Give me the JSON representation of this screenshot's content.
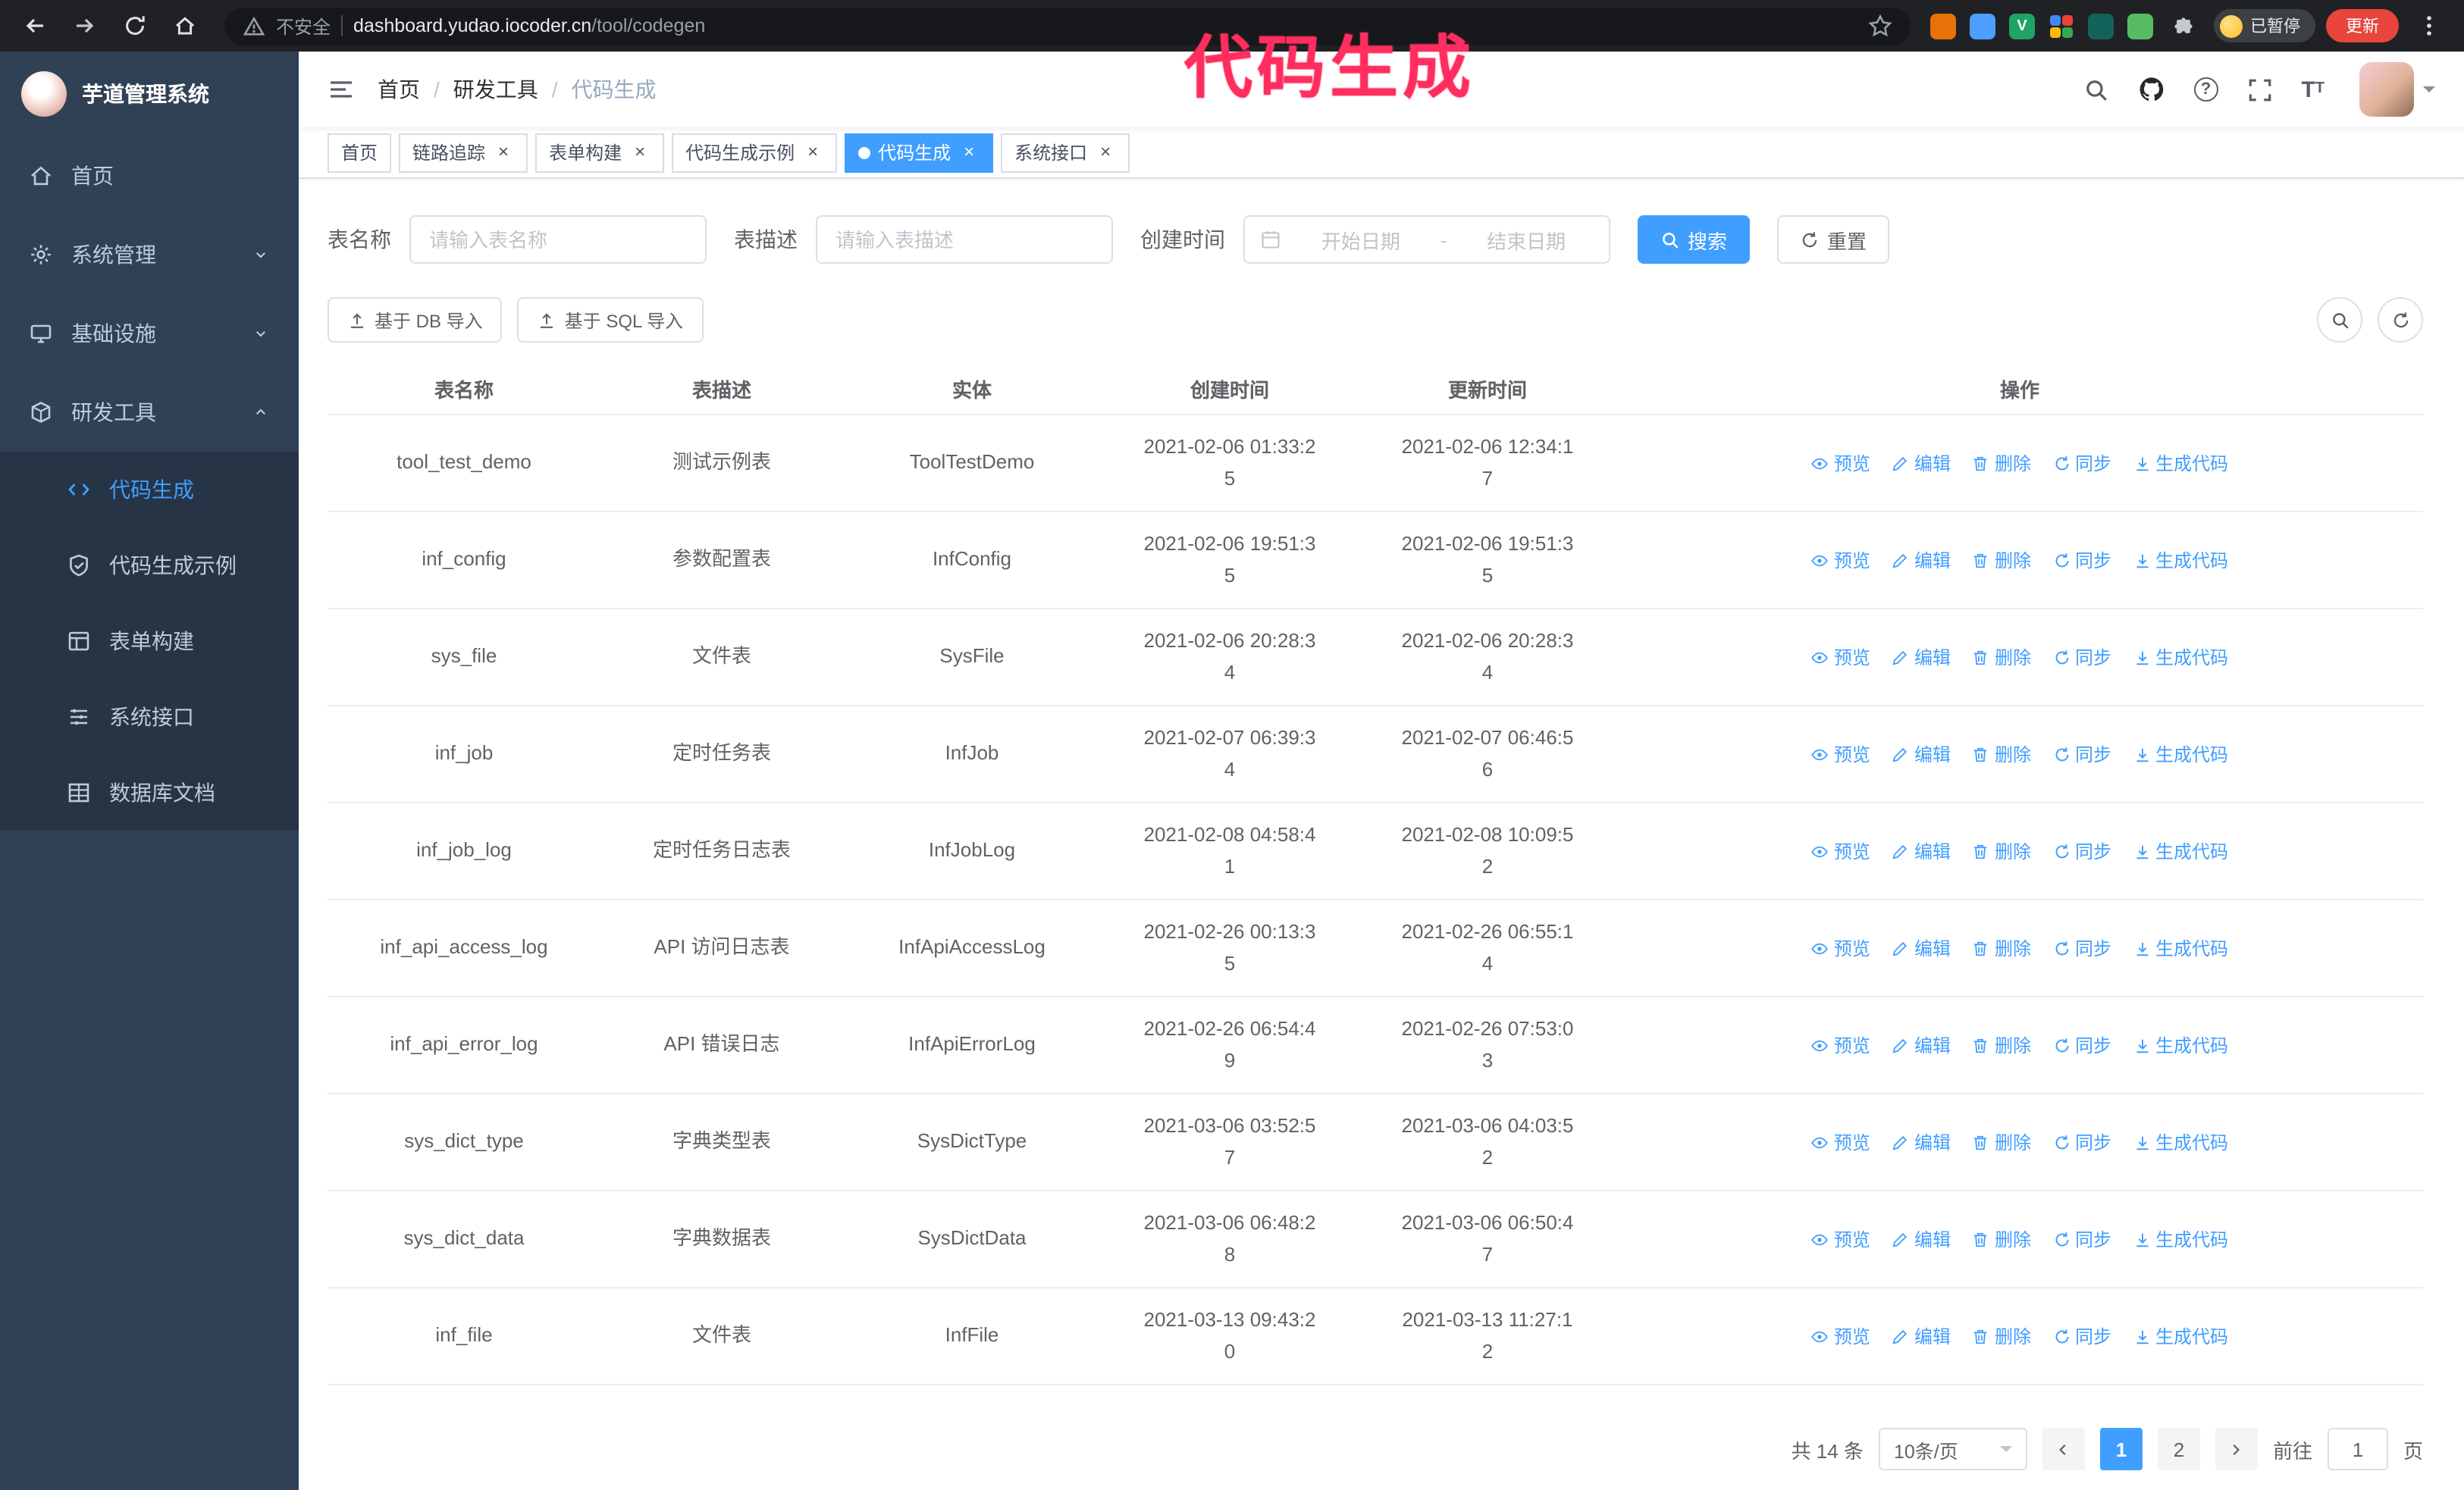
{
  "theme": {
    "primary": "#409EFF",
    "sidebar_bg": "#304156",
    "submenu_bg": "#263445",
    "chrome_bg": "#202124",
    "annotation_color": "#ff2e5f"
  },
  "browser": {
    "security_label": "不安全",
    "url_host": "dashboard.yudao.iocoder.cn",
    "url_path": "/tool/codegen",
    "paused_label": "已暂停",
    "update_label": "更新",
    "extensions": [
      {
        "name": "extension-orange",
        "color": "#e8710a"
      },
      {
        "name": "extension-blue",
        "color": "#4d9fff"
      },
      {
        "name": "extension-green-v",
        "color": "#1fa463",
        "glyph": "V"
      },
      {
        "name": "extension-multicolor",
        "colors": [
          "#4285f4",
          "#ea4335",
          "#fbbc04",
          "#34a853"
        ]
      },
      {
        "name": "extension-teal",
        "color": "#14635a"
      },
      {
        "name": "extension-green",
        "color": "#57bb63"
      }
    ]
  },
  "annotation": {
    "text": "代码生成"
  },
  "sidebar": {
    "app_title": "芋道管理系统",
    "items": [
      {
        "label": "首页",
        "icon": "home-icon"
      },
      {
        "label": "系统管理",
        "icon": "gear-icon"
      },
      {
        "label": "基础设施",
        "icon": "infrastructure-icon"
      },
      {
        "label": "研发工具",
        "icon": "tools-icon"
      }
    ],
    "subitems": [
      {
        "label": "代码生成",
        "icon": "code-icon",
        "active": true
      },
      {
        "label": "代码生成示例",
        "icon": "example-icon"
      },
      {
        "label": "表单构建",
        "icon": "form-icon"
      },
      {
        "label": "系统接口",
        "icon": "api-icon"
      },
      {
        "label": "数据库文档",
        "icon": "database-icon"
      }
    ]
  },
  "header": {
    "breadcrumb": [
      "首页",
      "研发工具",
      "代码生成"
    ],
    "breadcrumb_separator": "/"
  },
  "tabs": [
    {
      "label": "首页",
      "closable": false
    },
    {
      "label": "链路追踪",
      "closable": true
    },
    {
      "label": "表单构建",
      "closable": true
    },
    {
      "label": "代码生成示例",
      "closable": true
    },
    {
      "label": "代码生成",
      "closable": true,
      "active": true
    },
    {
      "label": "系统接口",
      "closable": true
    }
  ],
  "filters": {
    "table_name_label": "表名称",
    "table_name_placeholder": "请输入表名称",
    "table_desc_label": "表描述",
    "table_desc_placeholder": "请输入表描述",
    "create_time_label": "创建时间",
    "date_start_placeholder": "开始日期",
    "date_separator": "-",
    "date_end_placeholder": "结束日期",
    "search_label": "搜索",
    "reset_label": "重置"
  },
  "toolbar": {
    "import_db_label": "基于 DB 导入",
    "import_sql_label": "基于 SQL 导入"
  },
  "table": {
    "columns": [
      "表名称",
      "表描述",
      "实体",
      "创建时间",
      "更新时间",
      "操作"
    ],
    "actions": [
      {
        "label": "预览",
        "icon": "eye",
        "name": "preview-action"
      },
      {
        "label": "编辑",
        "icon": "edit",
        "name": "edit-action"
      },
      {
        "label": "删除",
        "icon": "trash",
        "name": "delete-action"
      },
      {
        "label": "同步",
        "icon": "sync",
        "name": "sync-action"
      },
      {
        "label": "生成代码",
        "icon": "download",
        "name": "generate-code-action"
      }
    ],
    "rows": [
      {
        "name": "tool_test_demo",
        "desc": "测试示例表",
        "entity": "ToolTestDemo",
        "created": "2021-02-06 01:33:25",
        "updated": "2021-02-06 12:34:17"
      },
      {
        "name": "inf_config",
        "desc": "参数配置表",
        "entity": "InfConfig",
        "created": "2021-02-06 19:51:35",
        "updated": "2021-02-06 19:51:35"
      },
      {
        "name": "sys_file",
        "desc": "文件表",
        "entity": "SysFile",
        "created": "2021-02-06 20:28:34",
        "updated": "2021-02-06 20:28:34"
      },
      {
        "name": "inf_job",
        "desc": "定时任务表",
        "entity": "InfJob",
        "created": "2021-02-07 06:39:34",
        "updated": "2021-02-07 06:46:56"
      },
      {
        "name": "inf_job_log",
        "desc": "定时任务日志表",
        "entity": "InfJobLog",
        "created": "2021-02-08 04:58:41",
        "updated": "2021-02-08 10:09:52"
      },
      {
        "name": "inf_api_access_log",
        "desc": "API 访问日志表",
        "entity": "InfApiAccessLog",
        "created": "2021-02-26 00:13:35",
        "updated": "2021-02-26 06:55:14"
      },
      {
        "name": "inf_api_error_log",
        "desc": "API 错误日志",
        "entity": "InfApiErrorLog",
        "created": "2021-02-26 06:54:49",
        "updated": "2021-02-26 07:53:03"
      },
      {
        "name": "sys_dict_type",
        "desc": "字典类型表",
        "entity": "SysDictType",
        "created": "2021-03-06 03:52:57",
        "updated": "2021-03-06 04:03:52"
      },
      {
        "name": "sys_dict_data",
        "desc": "字典数据表",
        "entity": "SysDictData",
        "created": "2021-03-06 06:48:28",
        "updated": "2021-03-06 06:50:47"
      },
      {
        "name": "inf_file",
        "desc": "文件表",
        "entity": "InfFile",
        "created": "2021-03-13 09:43:20",
        "updated": "2021-03-13 11:27:12"
      }
    ]
  },
  "pagination": {
    "total": "共 14 条",
    "page_size": "10条/页",
    "pages": [
      "1",
      "2"
    ],
    "active_page": "1",
    "goto_label": "前往",
    "goto_value": "1",
    "unit_label": "页"
  }
}
